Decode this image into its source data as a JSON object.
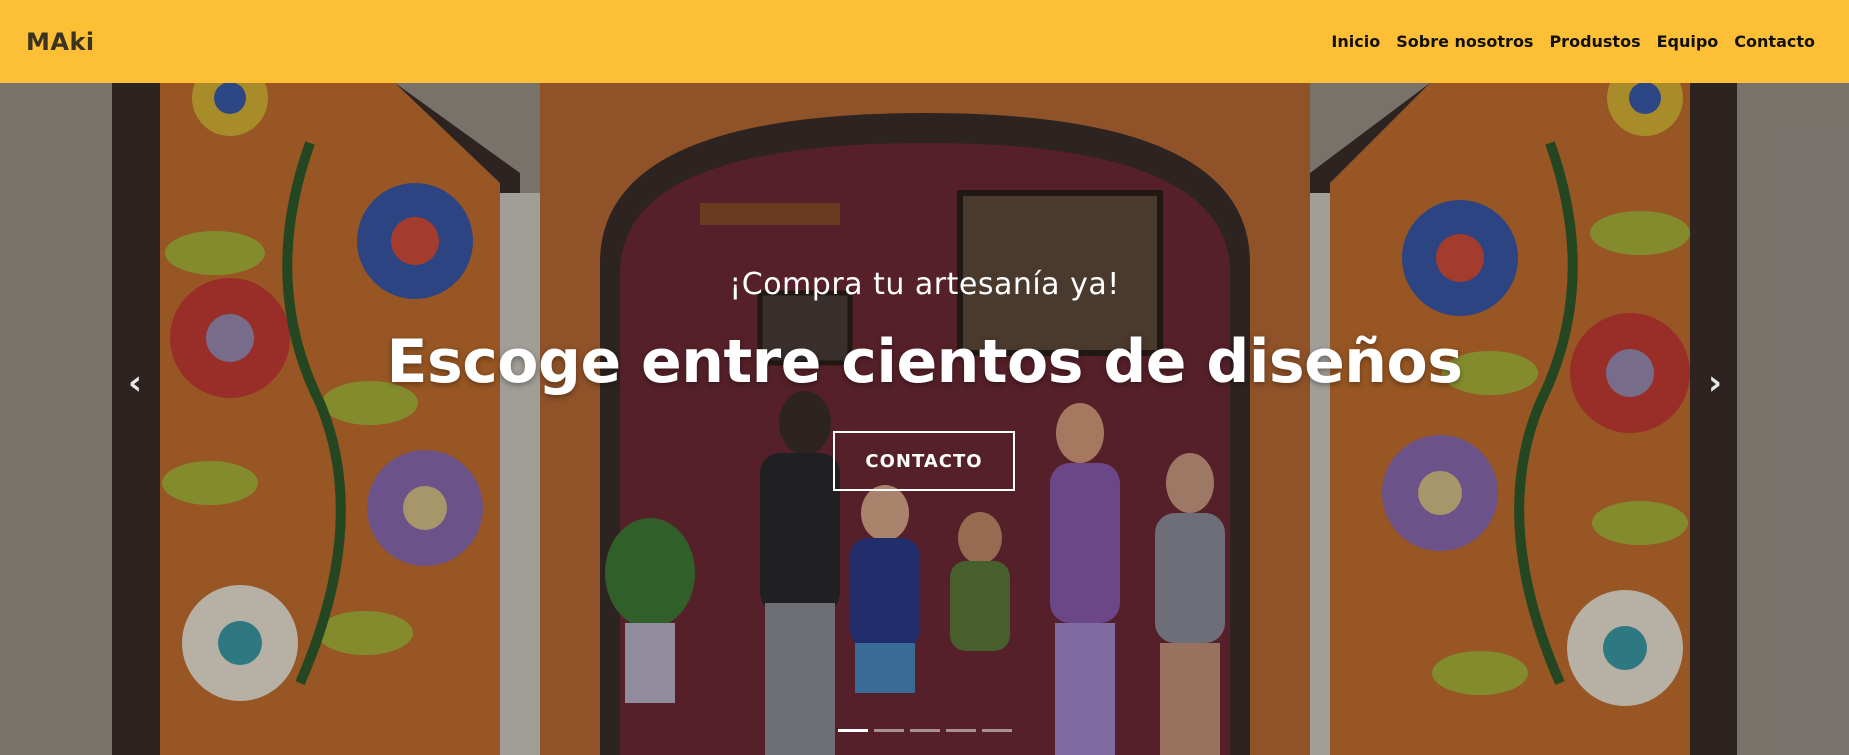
{
  "navbar": {
    "brand": "MAki",
    "links": [
      "Inicio",
      "Sobre nosotros",
      "Produstos",
      "Equipo",
      "Contacto"
    ]
  },
  "hero": {
    "subtitle": "¡Compra tu artesanía ya!",
    "title": "Escoge entre cientos de diseños",
    "cta_label": "CONTACTO",
    "prev_icon": "‹",
    "next_icon": "›",
    "slide_count": 5,
    "active_slide": 1
  },
  "colors": {
    "navbar_bg": "#fcbf35",
    "brand_text": "#3a3320",
    "hero_text": "#ffffff"
  }
}
